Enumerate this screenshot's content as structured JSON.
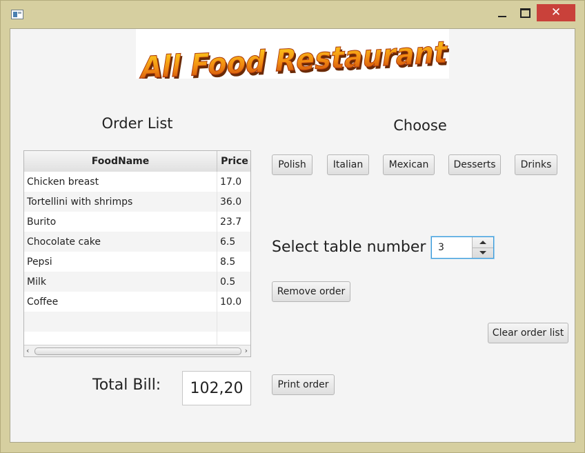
{
  "window": {
    "icon": "app-window-icon"
  },
  "logo_text": "All Food Restaurant",
  "order_list": {
    "title": "Order List",
    "columns": [
      "FoodName",
      "Price"
    ],
    "rows": [
      {
        "name": "Chicken breast",
        "price": "17.0"
      },
      {
        "name": "Tortellini with shrimps",
        "price": "36.0"
      },
      {
        "name": "Burito",
        "price": "23.7"
      },
      {
        "name": "Chocolate cake",
        "price": "6.5"
      },
      {
        "name": "Pepsi",
        "price": "8.5"
      },
      {
        "name": "Milk",
        "price": "0.5"
      },
      {
        "name": "Coffee",
        "price": "10.0"
      }
    ]
  },
  "choose": {
    "title": "Choose",
    "categories": [
      "Polish",
      "Italian",
      "Mexican",
      "Desserts",
      "Drinks"
    ]
  },
  "table_select": {
    "label": "Select table number",
    "value": "3"
  },
  "buttons": {
    "remove_order": "Remove order",
    "clear_order_list": "Clear order list",
    "print_order": "Print order"
  },
  "total": {
    "label": "Total Bill:",
    "value": "102,20"
  },
  "colors": {
    "logo_orange": "#e8620c",
    "logo_yellow": "#ffd21e",
    "close_red": "#c9413a",
    "focus_blue": "#3a9ad9"
  }
}
